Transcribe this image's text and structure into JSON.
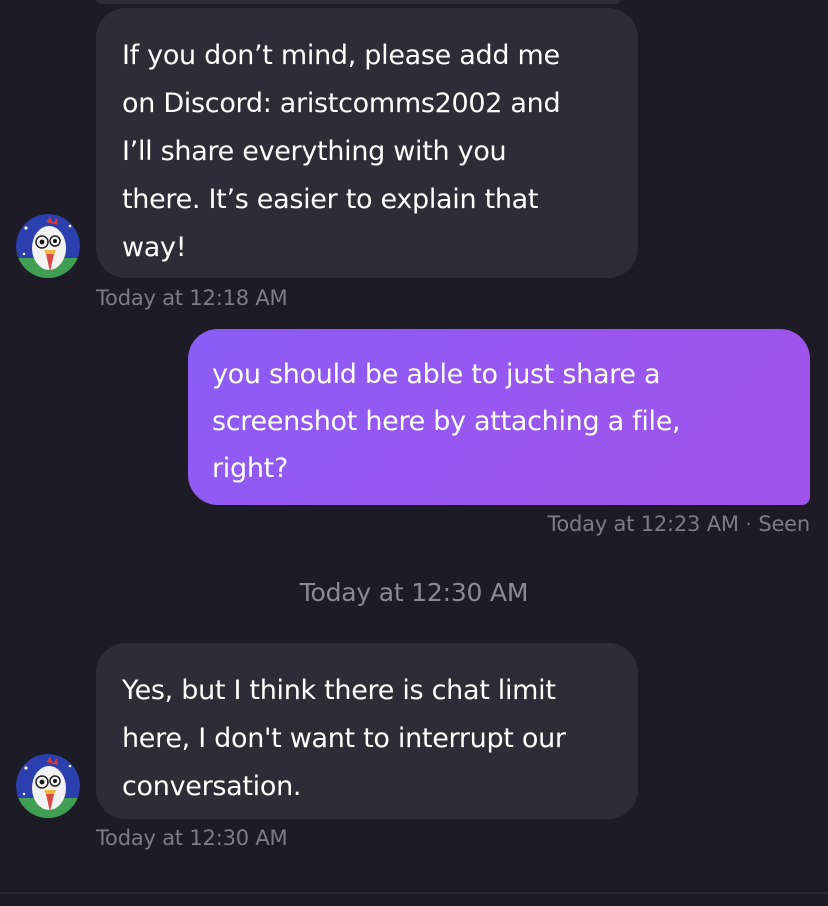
{
  "messages": [
    {
      "text": "If you don’t mind, please add me\non Discord: aristcomms2002 and\nI’ll share everything with you\nthere. It’s easier to explain that\nway!",
      "timestamp": "Today at 12:18 AM"
    },
    {
      "text": "you should be able to just share a\nscreenshot here by attaching a file,\nright?",
      "timestamp": "Today at 12:23 AM",
      "separator": "·",
      "status": "Seen"
    },
    {
      "text": "Yes, but I think there is chat limit\nhere, I don't want to interrupt our\nconversation.",
      "timestamp": "Today at 12:30 AM"
    }
  ],
  "day_divider": "Today at 12:30 AM",
  "colors": {
    "background": "#1d1c26",
    "incoming_bubble": "#2e2d37",
    "outgoing_bubble": "#9a56ee",
    "timestamp": "#7c7b86"
  },
  "icons": {
    "avatar": "rooster-avatar"
  }
}
